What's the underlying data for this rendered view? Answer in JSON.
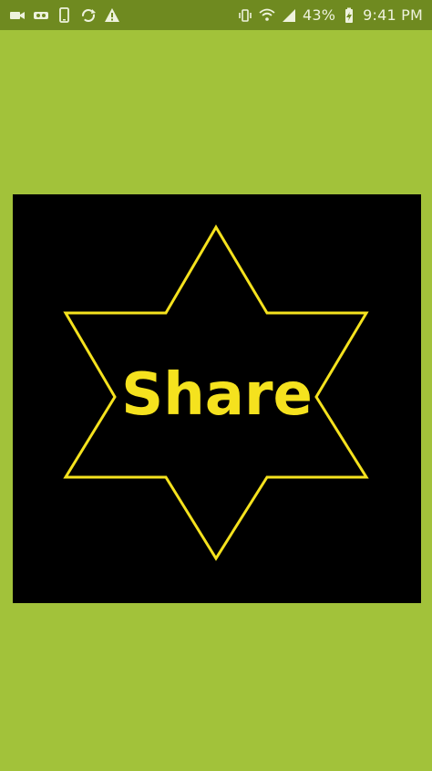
{
  "status_bar": {
    "left_icons": [
      "camera-icon",
      "voicemail-icon",
      "phone-device-icon",
      "sync-icon",
      "warning-icon"
    ],
    "right_icons": [
      "vibrate-icon",
      "wifi-icon",
      "signal-icon"
    ],
    "battery_percent": "43%",
    "battery_icon": "battery-charging-icon",
    "time": "9:41 PM"
  },
  "share_card": {
    "label": "Share",
    "star_icon": "six-point-star-icon"
  },
  "colors": {
    "background": "#a2c23a",
    "status_bar": "#6f8a20",
    "card_background": "#000000",
    "accent_yellow": "#f5e21e"
  }
}
